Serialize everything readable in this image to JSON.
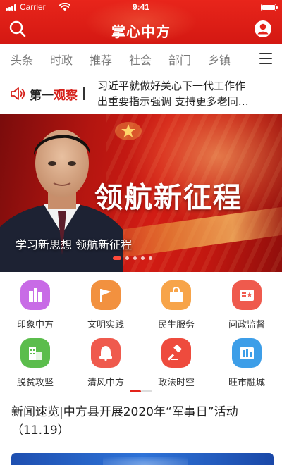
{
  "status_bar": {
    "carrier": "Carrier",
    "time": "9:41",
    "battery_level": 1.0
  },
  "header": {
    "title": "掌心中方",
    "search_icon": "search-icon",
    "profile_icon": "user-profile-icon"
  },
  "tabs": [
    {
      "label": "头条"
    },
    {
      "label": "时政"
    },
    {
      "label": "推荐"
    },
    {
      "label": "社会"
    },
    {
      "label": "部门"
    },
    {
      "label": "乡镇"
    }
  ],
  "menu_icon": "hamburger-menu-icon",
  "first_observe": {
    "label_prefix": "第一",
    "label_highlight": "观察",
    "news_line1": "习近平就做好关心下一代工作作",
    "news_line2": "出重要指示强调 支持更多老同…"
  },
  "banner": {
    "headline": "领航新征程",
    "caption": "学习新思想 领航新征程",
    "slide_count": 5,
    "active_slide": 0
  },
  "grid": {
    "items": [
      {
        "label": "印象中方",
        "icon": "buildings-icon",
        "color": "#c86be6"
      },
      {
        "label": "文明实践",
        "icon": "flag-icon",
        "color": "#f2913f"
      },
      {
        "label": "民生服务",
        "icon": "shopping-bag-icon",
        "color": "#f7a449"
      },
      {
        "label": "问政监督",
        "icon": "document-icon",
        "color": "#ef5a4d"
      },
      {
        "label": "脱贫攻坚",
        "icon": "house-icon",
        "color": "#5bbd4c"
      },
      {
        "label": "清风中方",
        "icon": "bell-icon",
        "color": "#ef5a4d"
      },
      {
        "label": "政法时空",
        "icon": "gavel-icon",
        "color": "#ee4b3d"
      },
      {
        "label": "旺市融城",
        "icon": "book-icon",
        "color": "#3d9ee8"
      }
    ],
    "page_count": 2,
    "active_page": 0
  },
  "article": {
    "title": "新闻速览|中方县开展2020年“军事日”活动（11.19）"
  },
  "colors": {
    "brand_red": "#e3231a",
    "tab_text": "#777777",
    "highlight": "#d6201a"
  }
}
